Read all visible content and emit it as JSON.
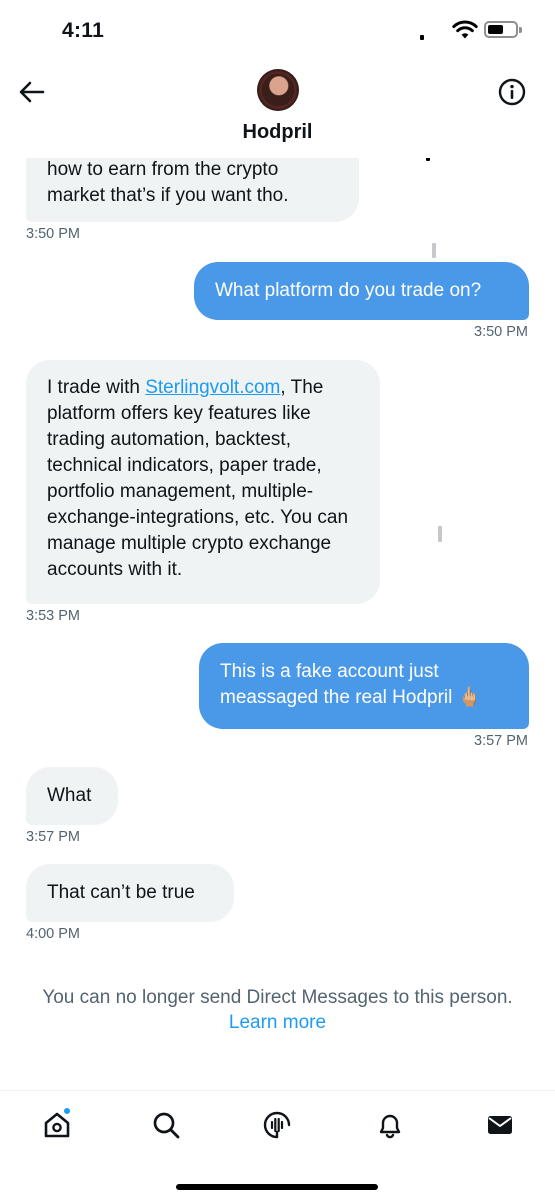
{
  "status_bar": {
    "time": "4:11"
  },
  "header": {
    "contact_name": "Hodpril"
  },
  "messages": [
    {
      "direction": "incoming",
      "text": "how to earn from the crypto market that’s if you want tho.",
      "time": "3:50 PM"
    },
    {
      "direction": "outgoing",
      "text": "What platform do you trade on?",
      "time": "3:50 PM"
    },
    {
      "direction": "incoming",
      "text_before_link": "I trade with ",
      "link": "Sterlingvolt.com",
      "text_after_link": ", The platform offers key features like trading automation, backtest, technical indicators, paper trade, portfolio management, multiple-exchange-integrations, etc. You can manage multiple crypto exchange accounts with it.",
      "time": "3:53 PM"
    },
    {
      "direction": "outgoing",
      "text": "This is a fake account just meassaged the real Hodpril 🖕🏼",
      "time": "3:57 PM"
    },
    {
      "direction": "incoming",
      "text": "What",
      "time": "3:57 PM"
    },
    {
      "direction": "incoming",
      "text": "That can’t be true",
      "time": "4:00 PM"
    }
  ],
  "notice": {
    "text": "You can no longer send Direct Messages to this person.",
    "link": "Learn more"
  },
  "tabbar": {
    "items": [
      "home-icon",
      "search-icon",
      "spaces-icon",
      "notifications-icon",
      "messages-icon"
    ],
    "home_has_badge": true
  },
  "colors": {
    "accent": "#1d9bf0",
    "outgoing_bubble": "#4a99e9",
    "incoming_bubble": "#eff3f4",
    "secondary_text": "#536471"
  }
}
